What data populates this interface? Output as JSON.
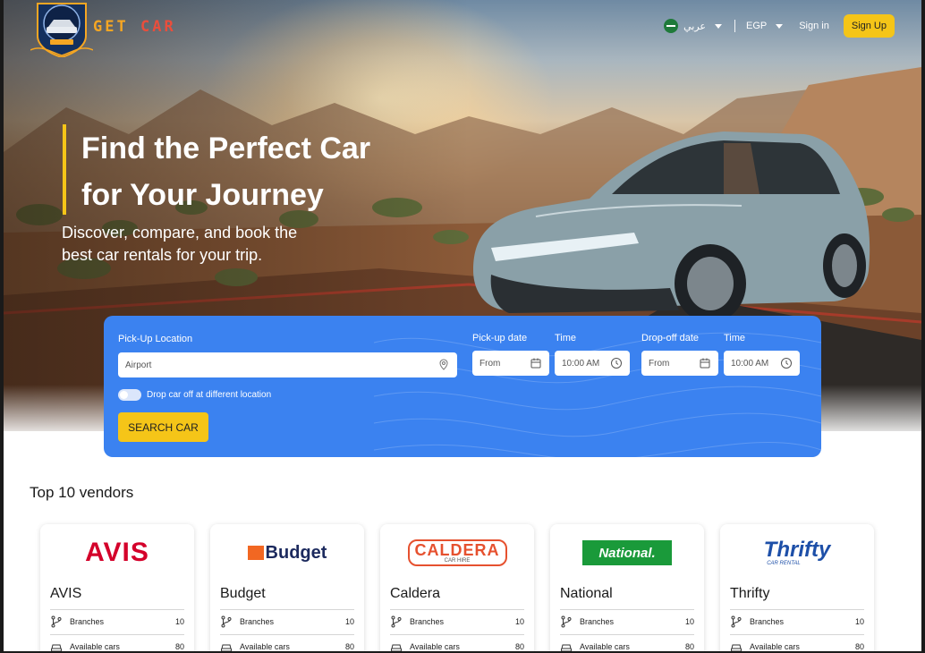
{
  "header": {
    "brand": [
      "GET",
      " ",
      "CAR"
    ],
    "language": "عربي",
    "currency": "EGP",
    "signin": "Sign in",
    "signup": "Sign Up"
  },
  "hero": {
    "headline_line1": "Find the Perfect Car",
    "headline_line2": "for Your Journey",
    "subtitle": "Discover, compare, and book the best car rentals for your trip."
  },
  "search": {
    "pickup_location_label": "Pick-Up Location",
    "pickup_location_placeholder": "Airport",
    "pickup_date_label": "Pick-up date",
    "pickup_date_placeholder": "From",
    "pickup_time_label": "Time",
    "pickup_time_value": "10:00 AM",
    "dropoff_date_label": "Drop-off date",
    "dropoff_date_placeholder": "From",
    "dropoff_time_label": "Time",
    "dropoff_time_value": "10:00 AM",
    "different_location_label": "Drop car off at different location",
    "different_location_on": false,
    "button": "SEARCH CAR"
  },
  "vendors": {
    "title": "Top 10 vendors",
    "branches_label": "Branches",
    "cars_label": "Available cars",
    "items": [
      {
        "name": "AVIS",
        "branches": "10",
        "cars": "80"
      },
      {
        "name": "Budget",
        "branches": "10",
        "cars": "80"
      },
      {
        "name": "Caldera",
        "branches": "10",
        "cars": "80"
      },
      {
        "name": "National",
        "branches": "10",
        "cars": "80"
      },
      {
        "name": "Thrifty",
        "branches": "10",
        "cars": "80"
      }
    ]
  },
  "logos": {
    "avis": "AVIS",
    "budget": "Budget",
    "caldera_main": "CALDERA",
    "caldera_sub": "CAR HIRE",
    "national": "National.",
    "thrifty_main": "Thrifty",
    "thrifty_sub": "CAR RENTAL"
  },
  "colors": {
    "accent": "#f5c518",
    "panel": "#3b82f0",
    "avis": "#d4002a",
    "budget_orange": "#f26722",
    "budget_navy": "#1c2a5e",
    "caldera": "#e6512f",
    "national": "#1a9a3a",
    "thrifty": "#1d4fa8"
  }
}
